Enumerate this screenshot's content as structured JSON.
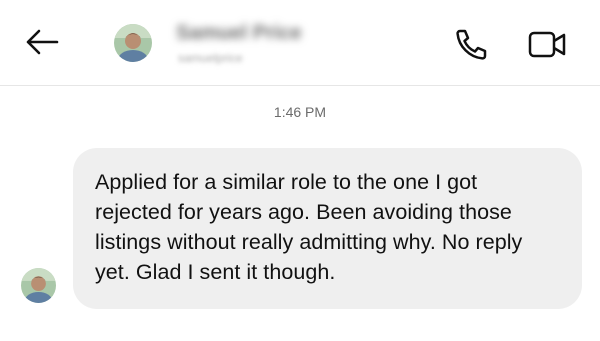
{
  "header": {
    "contact_name": "Samuel Price",
    "contact_username": "samuelprice",
    "back_icon": "arrow-left-icon",
    "call_icon": "phone-icon",
    "video_icon": "video-camera-icon"
  },
  "conversation": {
    "timestamp": "1:46 PM",
    "message": "Applied for a similar role to the one I got rejected for years ago. Been avoiding those listings without really admitting why. No reply yet. Glad I sent it though."
  },
  "colors": {
    "bubble_bg": "#efefef",
    "text": "#111111",
    "timestamp": "#6b6b6b",
    "divider": "#e6e6e6"
  }
}
